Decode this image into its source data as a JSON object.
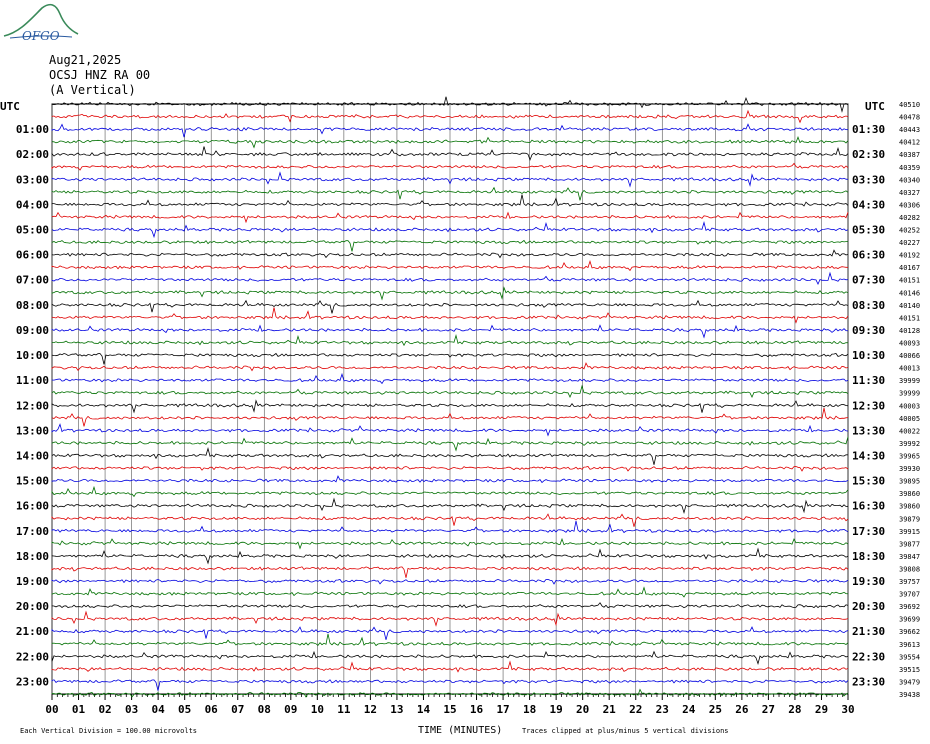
{
  "logo": {
    "text": "OFGO",
    "color": "#3a8a5a"
  },
  "header": {
    "date": "Aug21,2025",
    "station": "OCSJ HNZ RA 00",
    "component": "(A Vertical)"
  },
  "footer": {
    "scale_note": "Each Vertical Division = 100.00 microvolts",
    "xaxis_title": "TIME (MINUTES)",
    "clip_note": "Traces clipped at plus/minus 5 vertical divisions"
  },
  "chart_data": {
    "type": "line",
    "title": "",
    "xlabel": "TIME (MINUTES)",
    "left_axis_label": "UTC",
    "right_axis_label": "UTC",
    "x_ticks": [
      "00",
      "01",
      "02",
      "03",
      "04",
      "05",
      "06",
      "07",
      "08",
      "09",
      "10",
      "11",
      "12",
      "13",
      "14",
      "15",
      "16",
      "17",
      "18",
      "19",
      "20",
      "21",
      "22",
      "23",
      "24",
      "25",
      "26",
      "27",
      "28",
      "29",
      "30"
    ],
    "xlim": [
      0,
      30
    ],
    "left_ticks": [
      "01:00",
      "02:00",
      "03:00",
      "04:00",
      "05:00",
      "06:00",
      "07:00",
      "08:00",
      "09:00",
      "10:00",
      "11:00",
      "12:00",
      "13:00",
      "14:00",
      "15:00",
      "16:00",
      "17:00",
      "18:00",
      "19:00",
      "20:00",
      "21:00",
      "22:00",
      "23:00"
    ],
    "right_ticks": [
      "01:30",
      "02:30",
      "03:30",
      "04:30",
      "05:30",
      "06:30",
      "07:30",
      "08:30",
      "09:30",
      "10:30",
      "11:30",
      "12:30",
      "13:30",
      "14:30",
      "15:30",
      "16:30",
      "17:30",
      "18:30",
      "19:30",
      "20:30",
      "21:30",
      "22:30",
      "23:30"
    ],
    "trace_colors": [
      "#000000",
      "#e00000",
      "#0000e0",
      "#007000"
    ],
    "num_traces": 48,
    "trace_counts": [
      "40510",
      "40478",
      "40443",
      "40412",
      "40387",
      "40359",
      "40340",
      "40327",
      "40306",
      "40282",
      "40252",
      "40227",
      "40192",
      "40167",
      "40151",
      "40146",
      "40140",
      "40151",
      "40128",
      "40093",
      "40066",
      "40013",
      "39999",
      "39999",
      "40003",
      "40005",
      "40022",
      "39992",
      "39965",
      "39930",
      "39895",
      "39860",
      "39860",
      "39879",
      "39915",
      "39877",
      "39847",
      "39808",
      "39757",
      "39707",
      "39692",
      "39699",
      "39662",
      "39613",
      "39554",
      "39515",
      "39479",
      "39438"
    ],
    "grid": true
  }
}
